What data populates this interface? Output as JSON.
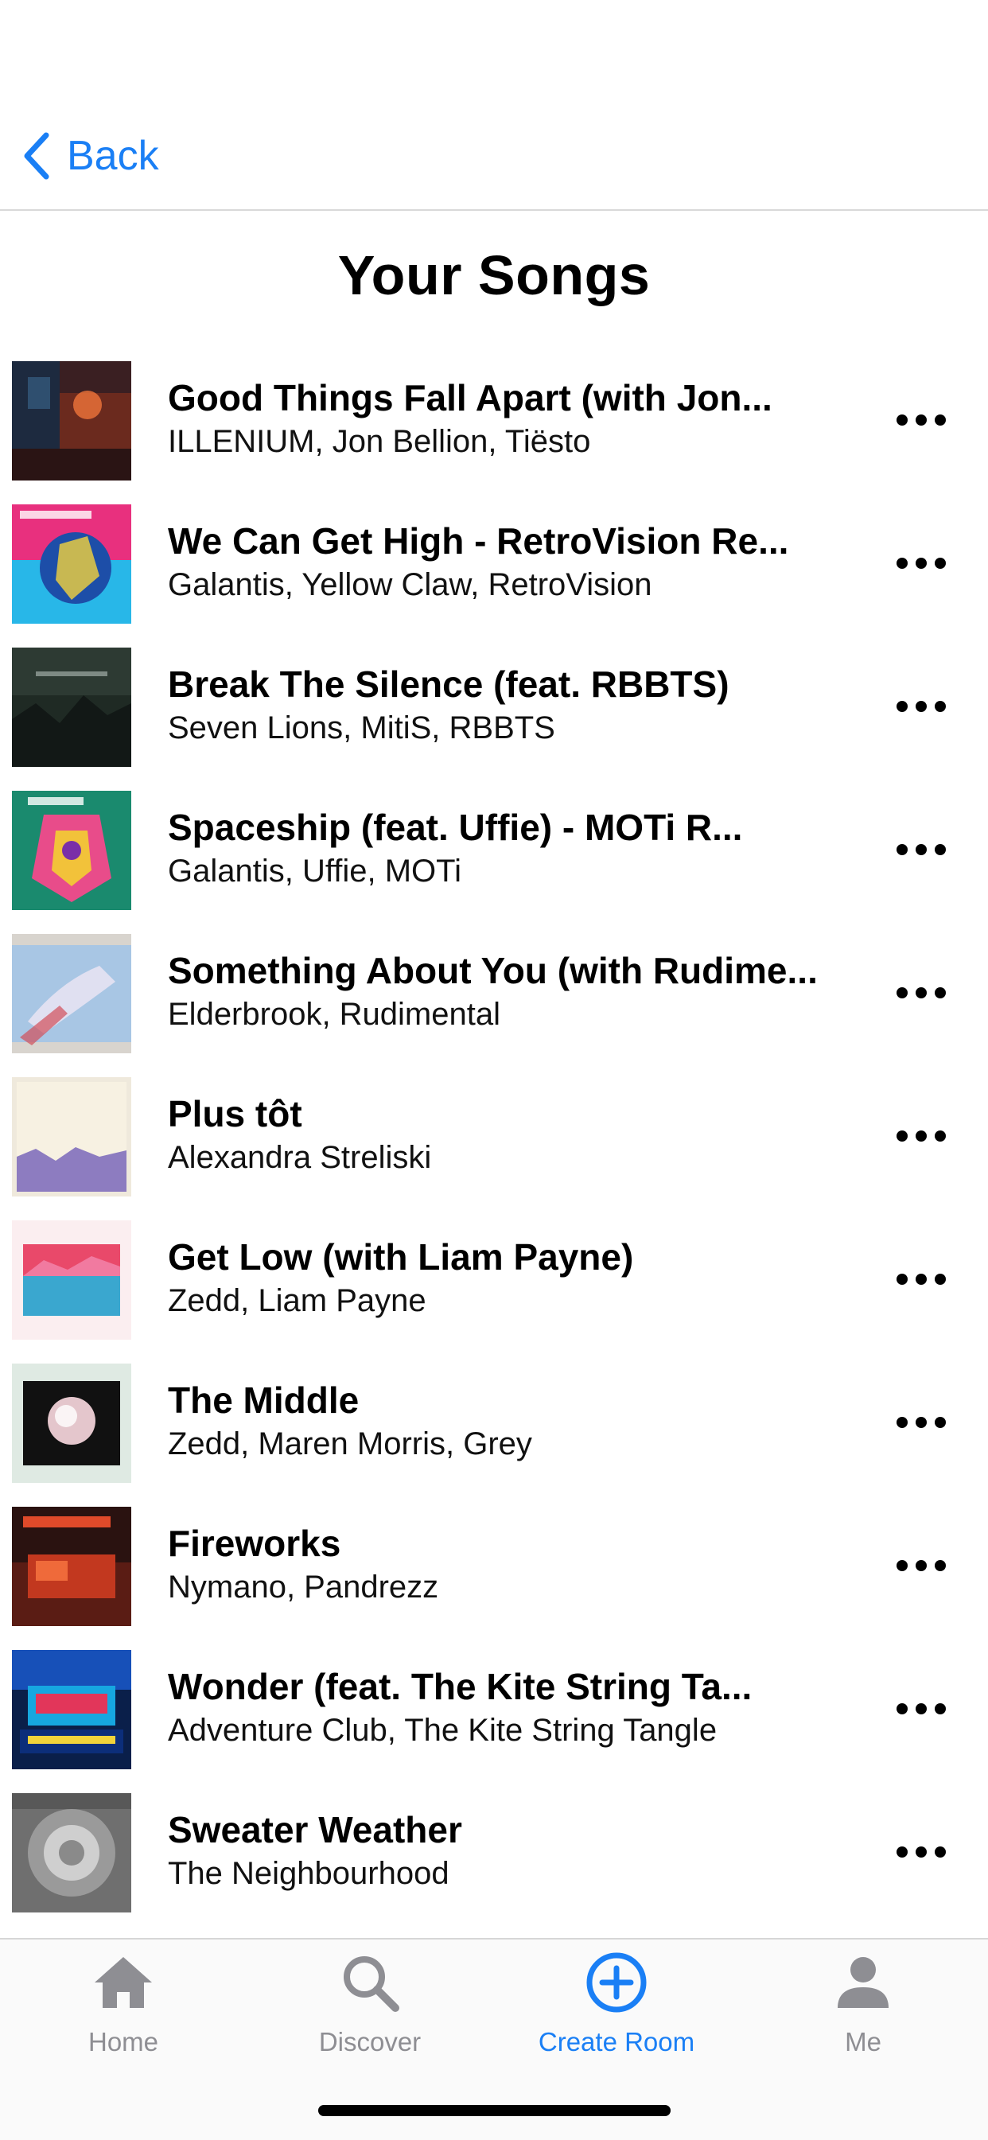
{
  "nav": {
    "back_label": "Back"
  },
  "page_title": "Your Songs",
  "songs": [
    {
      "title": "Good Things Fall Apart (with Jon...",
      "artists": "ILLENIUM, Jon Bellion, Tiësto"
    },
    {
      "title": "We Can Get High - RetroVision Re...",
      "artists": "Galantis, Yellow Claw, RetroVision"
    },
    {
      "title": "Break The Silence (feat. RBBTS)",
      "artists": "Seven Lions, MitiS, RBBTS"
    },
    {
      "title": "Spaceship (feat. Uffie) - MOTi R...",
      "artists": "Galantis, Uffie, MOTi"
    },
    {
      "title": "Something About You (with Rudime...",
      "artists": "Elderbrook, Rudimental"
    },
    {
      "title": "Plus tôt",
      "artists": "Alexandra Streliski"
    },
    {
      "title": "Get Low (with Liam Payne)",
      "artists": "Zedd, Liam Payne"
    },
    {
      "title": "The Middle",
      "artists": "Zedd, Maren Morris, Grey"
    },
    {
      "title": "Fireworks",
      "artists": "Nymano, Pandrezz"
    },
    {
      "title": "Wonder (feat. The Kite String Ta...",
      "artists": "Adventure Club, The Kite String Tangle"
    },
    {
      "title": "Sweater Weather",
      "artists": "The Neighbourhood"
    }
  ],
  "tabs": [
    {
      "label": "Home",
      "icon": "home-icon"
    },
    {
      "label": "Discover",
      "icon": "search-icon"
    },
    {
      "label": "Create Room",
      "icon": "plus-circle-icon"
    },
    {
      "label": "Me",
      "icon": "person-icon"
    }
  ],
  "active_tab": "Create Room",
  "colors": {
    "accent": "#1a7ff5",
    "inactive": "#8e8e93"
  }
}
